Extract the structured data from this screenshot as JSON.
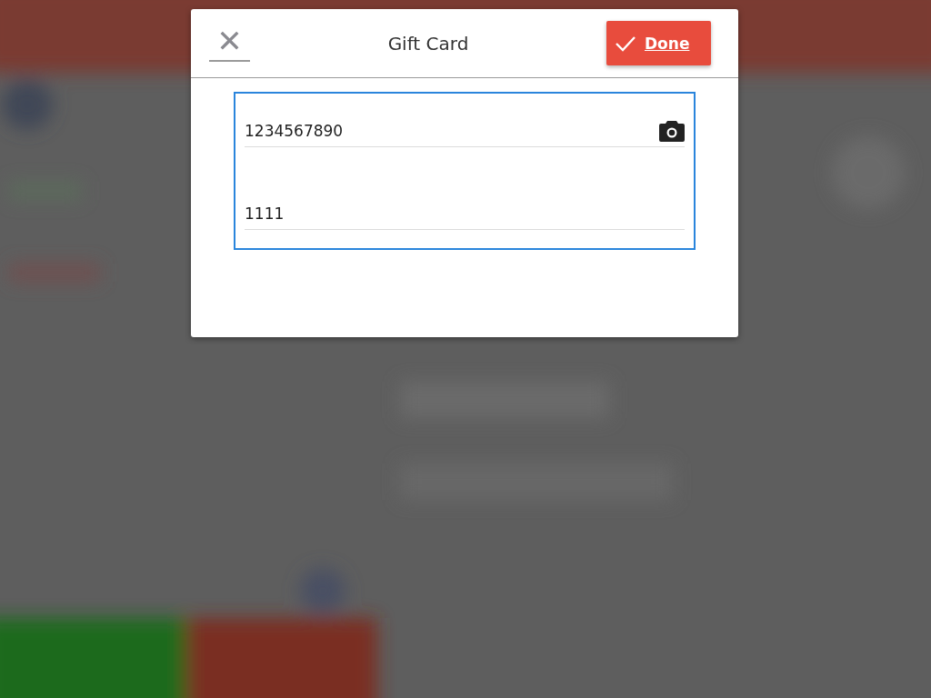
{
  "dialog": {
    "title": "Gift Card",
    "close_button": {
      "label": "✕"
    },
    "done_button": {
      "label": "Done"
    }
  },
  "fields": [
    {
      "value": "1234567890",
      "scan_button": true
    },
    {
      "value": "1111",
      "scan_button": false
    }
  ]
}
